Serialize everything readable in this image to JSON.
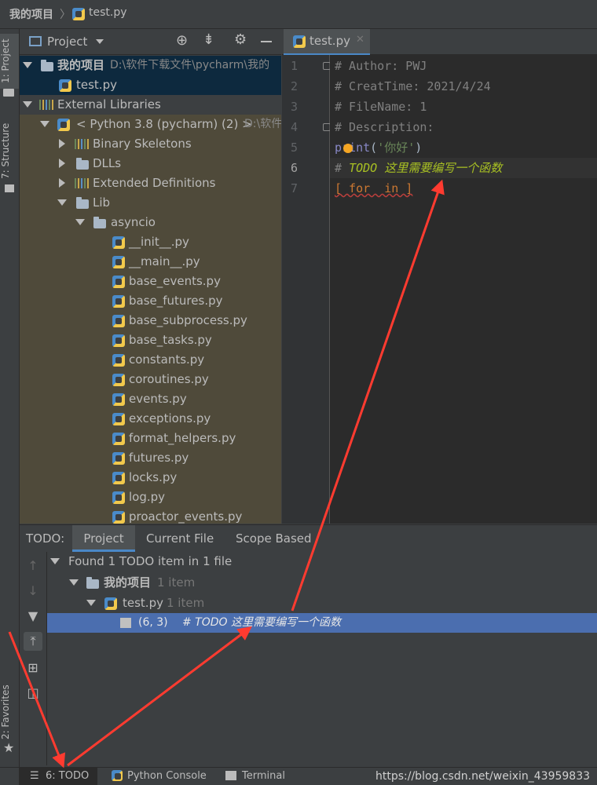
{
  "breadcrumb": {
    "project": "我的项目",
    "file": "test.py"
  },
  "sidebar_tabs": {
    "project": "1: Project",
    "structure": "7: Structure",
    "favorites": "2: Favorites"
  },
  "project_panel": {
    "title": "Project",
    "tree": {
      "root_label": "我的项目",
      "root_path": "D:\\软件下载文件\\pycharm\\我的",
      "root_file": "test.py",
      "external_libraries": "External Libraries",
      "python_sdk": "< Python 3.8 (pycharm) (2) >",
      "python_sdk_path": "D:\\软件",
      "binary_skeletons": "Binary Skeletons",
      "dlls": "DLLs",
      "extended_definitions": "Extended Definitions",
      "lib": "Lib",
      "asyncio": "asyncio",
      "files": [
        "__init__.py",
        "__main__.py",
        "base_events.py",
        "base_futures.py",
        "base_subprocess.py",
        "base_tasks.py",
        "constants.py",
        "coroutines.py",
        "events.py",
        "exceptions.py",
        "format_helpers.py",
        "futures.py",
        "locks.py",
        "log.py",
        "proactor_events.py"
      ]
    }
  },
  "editor": {
    "tab_label": "test.py",
    "line_numbers": [
      "1",
      "2",
      "3",
      "4",
      "5",
      "6",
      "7"
    ],
    "lines": {
      "l1": "# Author: PWJ",
      "l2": "# CreatTime: 2021/4/24",
      "l3": "# FileName: 1",
      "l4": "# Description:",
      "l5_fn": "print",
      "l5_paren_open": "(",
      "l5_str": "'你好'",
      "l5_paren_close": ")",
      "l6_hash": "# ",
      "l6_todo": "TODO 这里需要编写一个函数",
      "l7": "[ for  in ]"
    }
  },
  "todo_panel": {
    "label": "TODO:",
    "tabs": [
      "Project",
      "Current File",
      "Scope Based"
    ],
    "summary": "Found 1 TODO item in 1 file",
    "project_node": "我的项目",
    "project_count": "1 item",
    "file_node": "test.py",
    "file_count": "1 item",
    "item_position": "(6, 3)",
    "item_text": "# TODO 这里需要编写一个函数"
  },
  "bottom_bar": {
    "todo": "6: TODO",
    "python_console": "Python Console",
    "terminal": "Terminal",
    "watermark": "https://blog.csdn.net/weixin_43959833"
  },
  "colors": {
    "background": "#3c3f41",
    "editor_bg": "#2b2b2b",
    "selection": "#4b6eaf",
    "todo_text": "#a8c023",
    "comment": "#808080",
    "annotation_arrow": "#ff3b30"
  }
}
